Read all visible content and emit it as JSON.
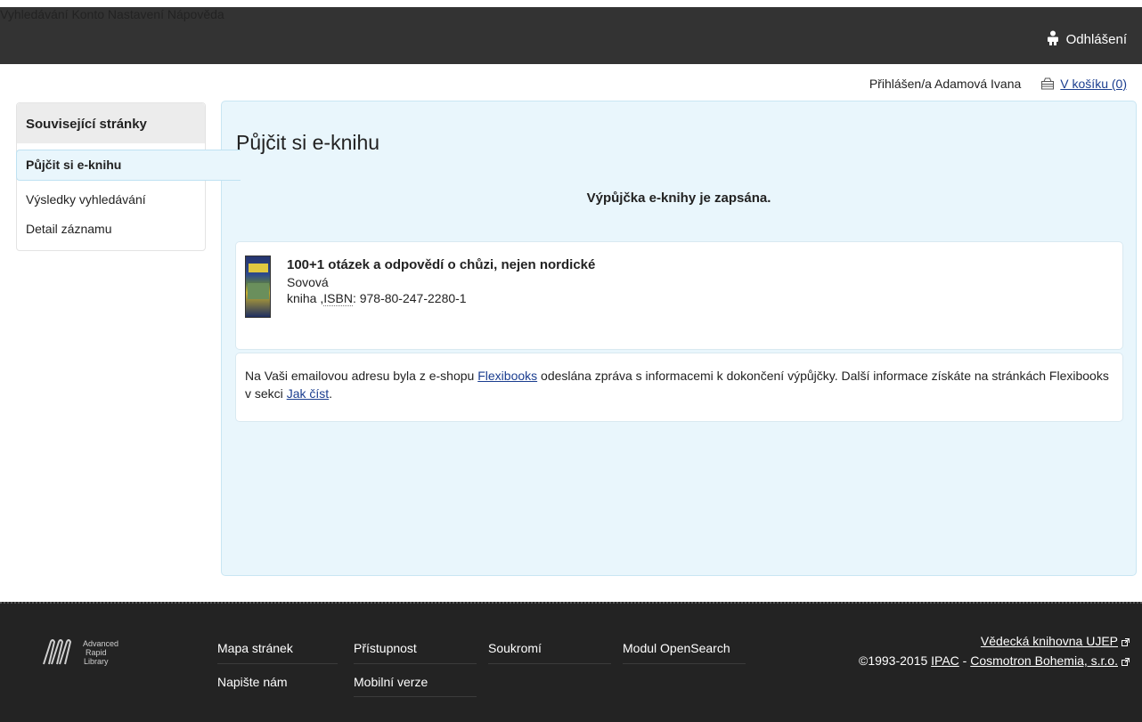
{
  "topnav": {
    "items": [
      "Vyhledávání",
      "Konto",
      "Nastavení",
      "Nápověda"
    ],
    "logout": "Odhlášení"
  },
  "userline": {
    "logged_in": "Přihlášen/a Adamová Ivana",
    "basket": "V košíku (0)"
  },
  "sidebar": {
    "title": "Související stránky",
    "items": [
      "Půjčit si e-knihu",
      "Výsledky vyhledávání",
      "Detail záznamu"
    ]
  },
  "main": {
    "title": "Půjčit si e-knihu",
    "status": "Výpůjčka e-knihy je zapsána.",
    "record": {
      "title": "100+1 otázek a odpovědí o chůzi, nejen nordické",
      "author": "Sovová",
      "type": "kniha ,",
      "isbn_label": "ISBN",
      "isbn_value": ": 978-80-247-2280-1"
    },
    "info": {
      "text1": "Na Vaši emailovou adresu byla z e-shopu ",
      "link1": "Flexibooks",
      "text2": " odeslána zpráva s informacemi k dokončení výpůjčky. Další informace získáte na stránkách Flexibooks v sekci ",
      "link2": "Jak číst",
      "text3": "."
    }
  },
  "footer": {
    "logo_lines": [
      "Advanced",
      "Rapid",
      "Library"
    ],
    "links": [
      "Mapa stránek",
      "Napište nám",
      "Přístupnost",
      "Mobilní verze",
      "Soukromí",
      "Modul OpenSearch"
    ],
    "library": "Vědecká knihovna UJEP",
    "copyright": "©1993-2015 ",
    "ipac": "IPAC",
    "dash": " - ",
    "cosmotron": "Cosmotron Bohemia, s.r.o."
  }
}
